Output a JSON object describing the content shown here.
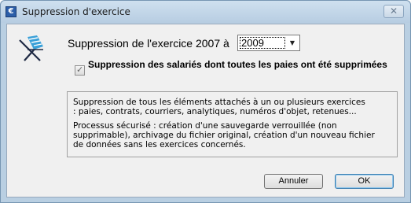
{
  "window": {
    "title": "Suppression d'exercice",
    "close_label": "✕"
  },
  "form": {
    "label": "Suppression de l'exercice 2007 à",
    "selected_year": "2009",
    "checkbox_checked": true,
    "checkbox_label": "Suppression des salariés dont toutes les paies ont été supprimées"
  },
  "info": {
    "paragraph1": "Suppression de tous les éléments attachés à un ou plusieurs exercices\n: paies, contrats, courriers, analytiques, numéros d'objet, retenues...",
    "paragraph2": "Processus sécurisé : création d'une sauvegarde verrouillée (non\nsupprimable), archivage du fichier original, création d'un nouveau fichier\nde données sans les exercices concernés."
  },
  "buttons": {
    "cancel": "Annuler",
    "ok": "OK"
  },
  "icons": {
    "app": "app-icon",
    "logo": "deckchair-logo-icon",
    "dropdown": "chevron-down-icon",
    "check": "checkmark-icon"
  }
}
